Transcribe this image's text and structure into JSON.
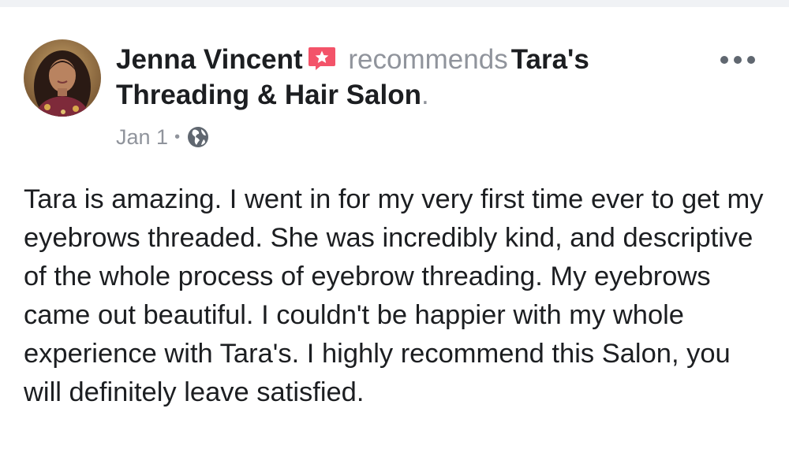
{
  "post": {
    "author": "Jenna Vincent",
    "verb": "recommends",
    "page": "Tara's Threading & Hair Salon",
    "period": ".",
    "date": "Jan 1",
    "separator": "•",
    "privacy_icon": "globe-icon",
    "recommend_icon": "recommendation-badge-icon",
    "more_icon": "more-options-icon",
    "body": "Tara is amazing. I went in for my very first time ever to get my eyebrows threaded. She was incredibly kind, and descriptive of the whole process of eyebrow threading. My eyebrows came out beautiful. I couldn't be happier with my whole experience with Tara's. I highly recommend this Salon, you will definitely leave satisfied."
  },
  "colors": {
    "recommend_badge": "#f35369",
    "secondary_text": "#90949c",
    "primary_text": "#1c1e21",
    "divider": "#f0f2f5"
  }
}
